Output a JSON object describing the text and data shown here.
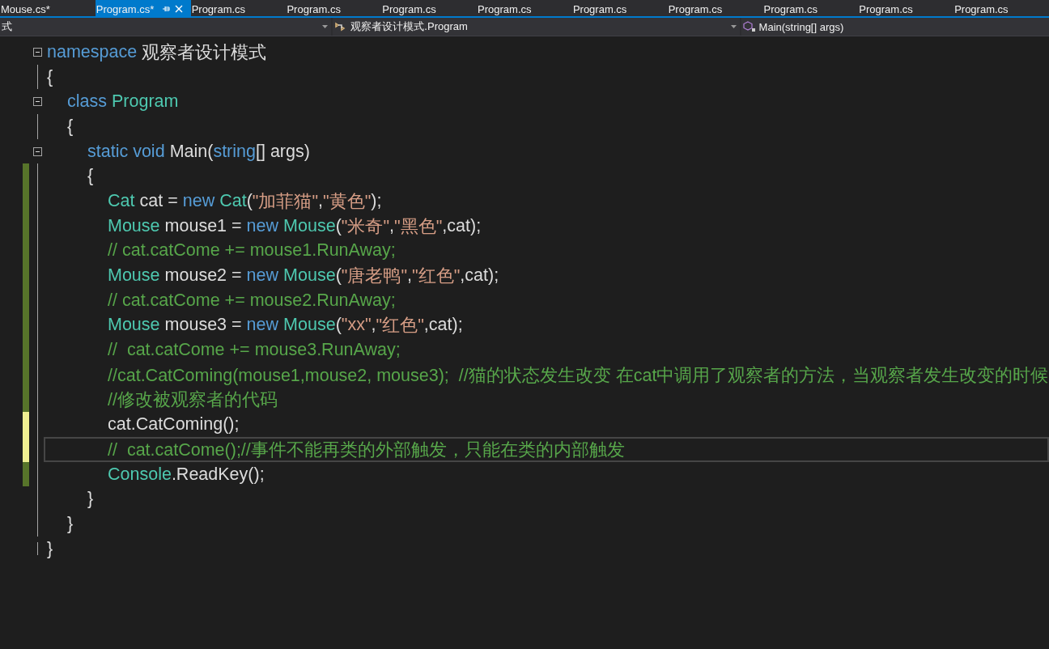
{
  "tabs": [
    {
      "label": "Mouse.cs*",
      "selected": false,
      "pinnable": false
    },
    {
      "label": "Program.cs*",
      "selected": true,
      "pinnable": true
    },
    {
      "label": "Program.cs",
      "selected": false,
      "pinnable": false
    },
    {
      "label": "Program.cs",
      "selected": false,
      "pinnable": false
    },
    {
      "label": "Program.cs",
      "selected": false,
      "pinnable": false
    },
    {
      "label": "Program.cs",
      "selected": false,
      "pinnable": false
    },
    {
      "label": "Program.cs",
      "selected": false,
      "pinnable": false
    },
    {
      "label": "Program.cs",
      "selected": false,
      "pinnable": false
    },
    {
      "label": "Program.cs",
      "selected": false,
      "pinnable": false
    },
    {
      "label": "Program.cs",
      "selected": false,
      "pinnable": false
    },
    {
      "label": "Program.cs",
      "selected": false,
      "pinnable": false
    }
  ],
  "navigation_bar": [
    {
      "kind": "project",
      "text": "式"
    },
    {
      "kind": "class",
      "text": "观察者设计模式.Program"
    },
    {
      "kind": "method",
      "text": "Main(string[] args)"
    }
  ],
  "code_lines": [
    {
      "collapsible": true,
      "modified": false,
      "current": false,
      "tokens": [
        {
          "kind": "keyword",
          "text": "namespace"
        },
        {
          "kind": "plain",
          "text": "观察者设计模式"
        }
      ]
    },
    {
      "collapsible": false,
      "modified": false,
      "current": false,
      "tokens": [
        {
          "kind": "plain",
          "text": "{"
        }
      ],
      "children": [
        {
          "collapsible": true,
          "modified": false,
          "current": false,
          "tokens": [
            {
              "kind": "keyword",
              "text": "class"
            },
            {
              "kind": "type",
              "text": "Program"
            }
          ]
        },
        {
          "collapsible": false,
          "modified": false,
          "current": false,
          "tokens": [
            {
              "kind": "plain",
              "text": "{"
            }
          ],
          "children": [
            {
              "collapsible": true,
              "modified": false,
              "current": false,
              "tokens": [
                {
                  "kind": "keyword",
                  "text": "static void"
                },
                {
                  "kind": "plain",
                  "text": "Main("
                },
                {
                  "kind": "keyword",
                  "text": "string"
                },
                {
                  "kind": "plain",
                  "text": "[] args)"
                }
              ]
            },
            {
              "collapsible": false,
              "modified": true,
              "saved": true,
              "current": false,
              "tokens": [
                {
                  "kind": "plain",
                  "text": "{"
                }
              ],
              "children": [
                {
                  "collapsible": false,
                  "modified": true,
                  "saved": true,
                  "current": false,
                  "tokens": [
                    {
                      "kind": "type",
                      "text": "Cat"
                    },
                    {
                      "kind": "plain",
                      "text": "cat ="
                    },
                    {
                      "kind": "keyword",
                      "text": "new"
                    },
                    {
                      "kind": "type",
                      "text": "Cat"
                    },
                    {
                      "kind": "plain",
                      "text": "("
                    },
                    {
                      "kind": "string",
                      "text": "\"加菲猫\""
                    },
                    {
                      "kind": "plain",
                      "text": ","
                    },
                    {
                      "kind": "string",
                      "text": "\"黄色\""
                    },
                    {
                      "kind": "plain",
                      "text": ");"
                    }
                  ]
                },
                {
                  "collapsible": false,
                  "modified": true,
                  "saved": true,
                  "current": false,
                  "tokens": [
                    {
                      "kind": "type",
                      "text": "Mouse"
                    },
                    {
                      "kind": "plain",
                      "text": "mouse1 ="
                    },
                    {
                      "kind": "keyword",
                      "text": "new"
                    },
                    {
                      "kind": "type",
                      "text": "Mouse"
                    },
                    {
                      "kind": "plain",
                      "text": "("
                    },
                    {
                      "kind": "string",
                      "text": "\"米奇\""
                    },
                    {
                      "kind": "plain",
                      "text": ","
                    },
                    {
                      "kind": "string",
                      "text": "\"黑色\""
                    },
                    {
                      "kind": "plain",
                      "text": ",cat);"
                    }
                  ]
                },
                {
                  "collapsible": false,
                  "modified": true,
                  "saved": true,
                  "current": false,
                  "tokens": [
                    {
                      "kind": "comment",
                      "text": "// cat.catCome += mouse1.RunAway;"
                    }
                  ]
                },
                {
                  "collapsible": false,
                  "modified": true,
                  "saved": true,
                  "current": false,
                  "tokens": [
                    {
                      "kind": "type",
                      "text": "Mouse"
                    },
                    {
                      "kind": "plain",
                      "text": "mouse2 ="
                    },
                    {
                      "kind": "keyword",
                      "text": "new"
                    },
                    {
                      "kind": "type",
                      "text": "Mouse"
                    },
                    {
                      "kind": "plain",
                      "text": "("
                    },
                    {
                      "kind": "string",
                      "text": "\"唐老鸭\""
                    },
                    {
                      "kind": "plain",
                      "text": ","
                    },
                    {
                      "kind": "string",
                      "text": "\"红色\""
                    },
                    {
                      "kind": "plain",
                      "text": ",cat);"
                    }
                  ]
                },
                {
                  "collapsible": false,
                  "modified": true,
                  "saved": true,
                  "current": false,
                  "tokens": [
                    {
                      "kind": "comment",
                      "text": "// cat.catCome += mouse2.RunAway;"
                    }
                  ]
                },
                {
                  "collapsible": false,
                  "modified": true,
                  "saved": true,
                  "current": false,
                  "tokens": [
                    {
                      "kind": "type",
                      "text": "Mouse"
                    },
                    {
                      "kind": "plain",
                      "text": "mouse3 ="
                    },
                    {
                      "kind": "keyword",
                      "text": "new"
                    },
                    {
                      "kind": "type",
                      "text": "Mouse"
                    },
                    {
                      "kind": "plain",
                      "text": "("
                    },
                    {
                      "kind": "string",
                      "text": "\"xx\""
                    },
                    {
                      "kind": "plain",
                      "text": ","
                    },
                    {
                      "kind": "string",
                      "text": "\"红色\""
                    },
                    {
                      "kind": "plain",
                      "text": ",cat);"
                    }
                  ]
                },
                {
                  "collapsible": false,
                  "modified": true,
                  "saved": true,
                  "current": false,
                  "tokens": [
                    {
                      "kind": "comment",
                      "text": "//  cat.catCome += mouse3.RunAway;"
                    }
                  ]
                },
                {
                  "collapsible": false,
                  "modified": true,
                  "saved": true,
                  "current": false,
                  "tokens": [
                    {
                      "kind": "comment",
                      "text": "//cat.CatComing(mouse1,mouse2, mouse3);  //猫的状态发生改变 在cat中调用了观察者的方法，当观察者发生改变的时候"
                    }
                  ]
                },
                {
                  "collapsible": false,
                  "modified": true,
                  "saved": true,
                  "current": false,
                  "tokens": [
                    {
                      "kind": "comment",
                      "text": "//修改被观察者的代码"
                    }
                  ]
                },
                {
                  "collapsible": false,
                  "modified": true,
                  "saved": false,
                  "current": false,
                  "tokens": [
                    {
                      "kind": "plain",
                      "text": "cat.CatComing();"
                    }
                  ]
                },
                {
                  "collapsible": false,
                  "modified": true,
                  "saved": false,
                  "current": true,
                  "tokens": [
                    {
                      "kind": "comment",
                      "text": "//  cat.catCome();//事件不能再类的外部触发，只能在类的内部触发"
                    }
                  ]
                },
                {
                  "collapsible": false,
                  "modified": true,
                  "saved": true,
                  "current": false,
                  "tokens": [
                    {
                      "kind": "type",
                      "text": "Console"
                    },
                    {
                      "kind": "plain",
                      "text": ".ReadKey();"
                    }
                  ]
                }
              ]
            },
            {
              "collapsible": false,
              "modified": false,
              "current": false,
              "tokens": [
                {
                  "kind": "plain",
                  "text": "}"
                }
              ]
            }
          ]
        },
        {
          "collapsible": false,
          "modified": false,
          "current": false,
          "tokens": [
            {
              "kind": "plain",
              "text": "}"
            }
          ]
        }
      ]
    },
    {
      "collapsible": false,
      "modified": false,
      "current": false,
      "tokens": [
        {
          "kind": "plain",
          "text": "}"
        }
      ]
    }
  ]
}
